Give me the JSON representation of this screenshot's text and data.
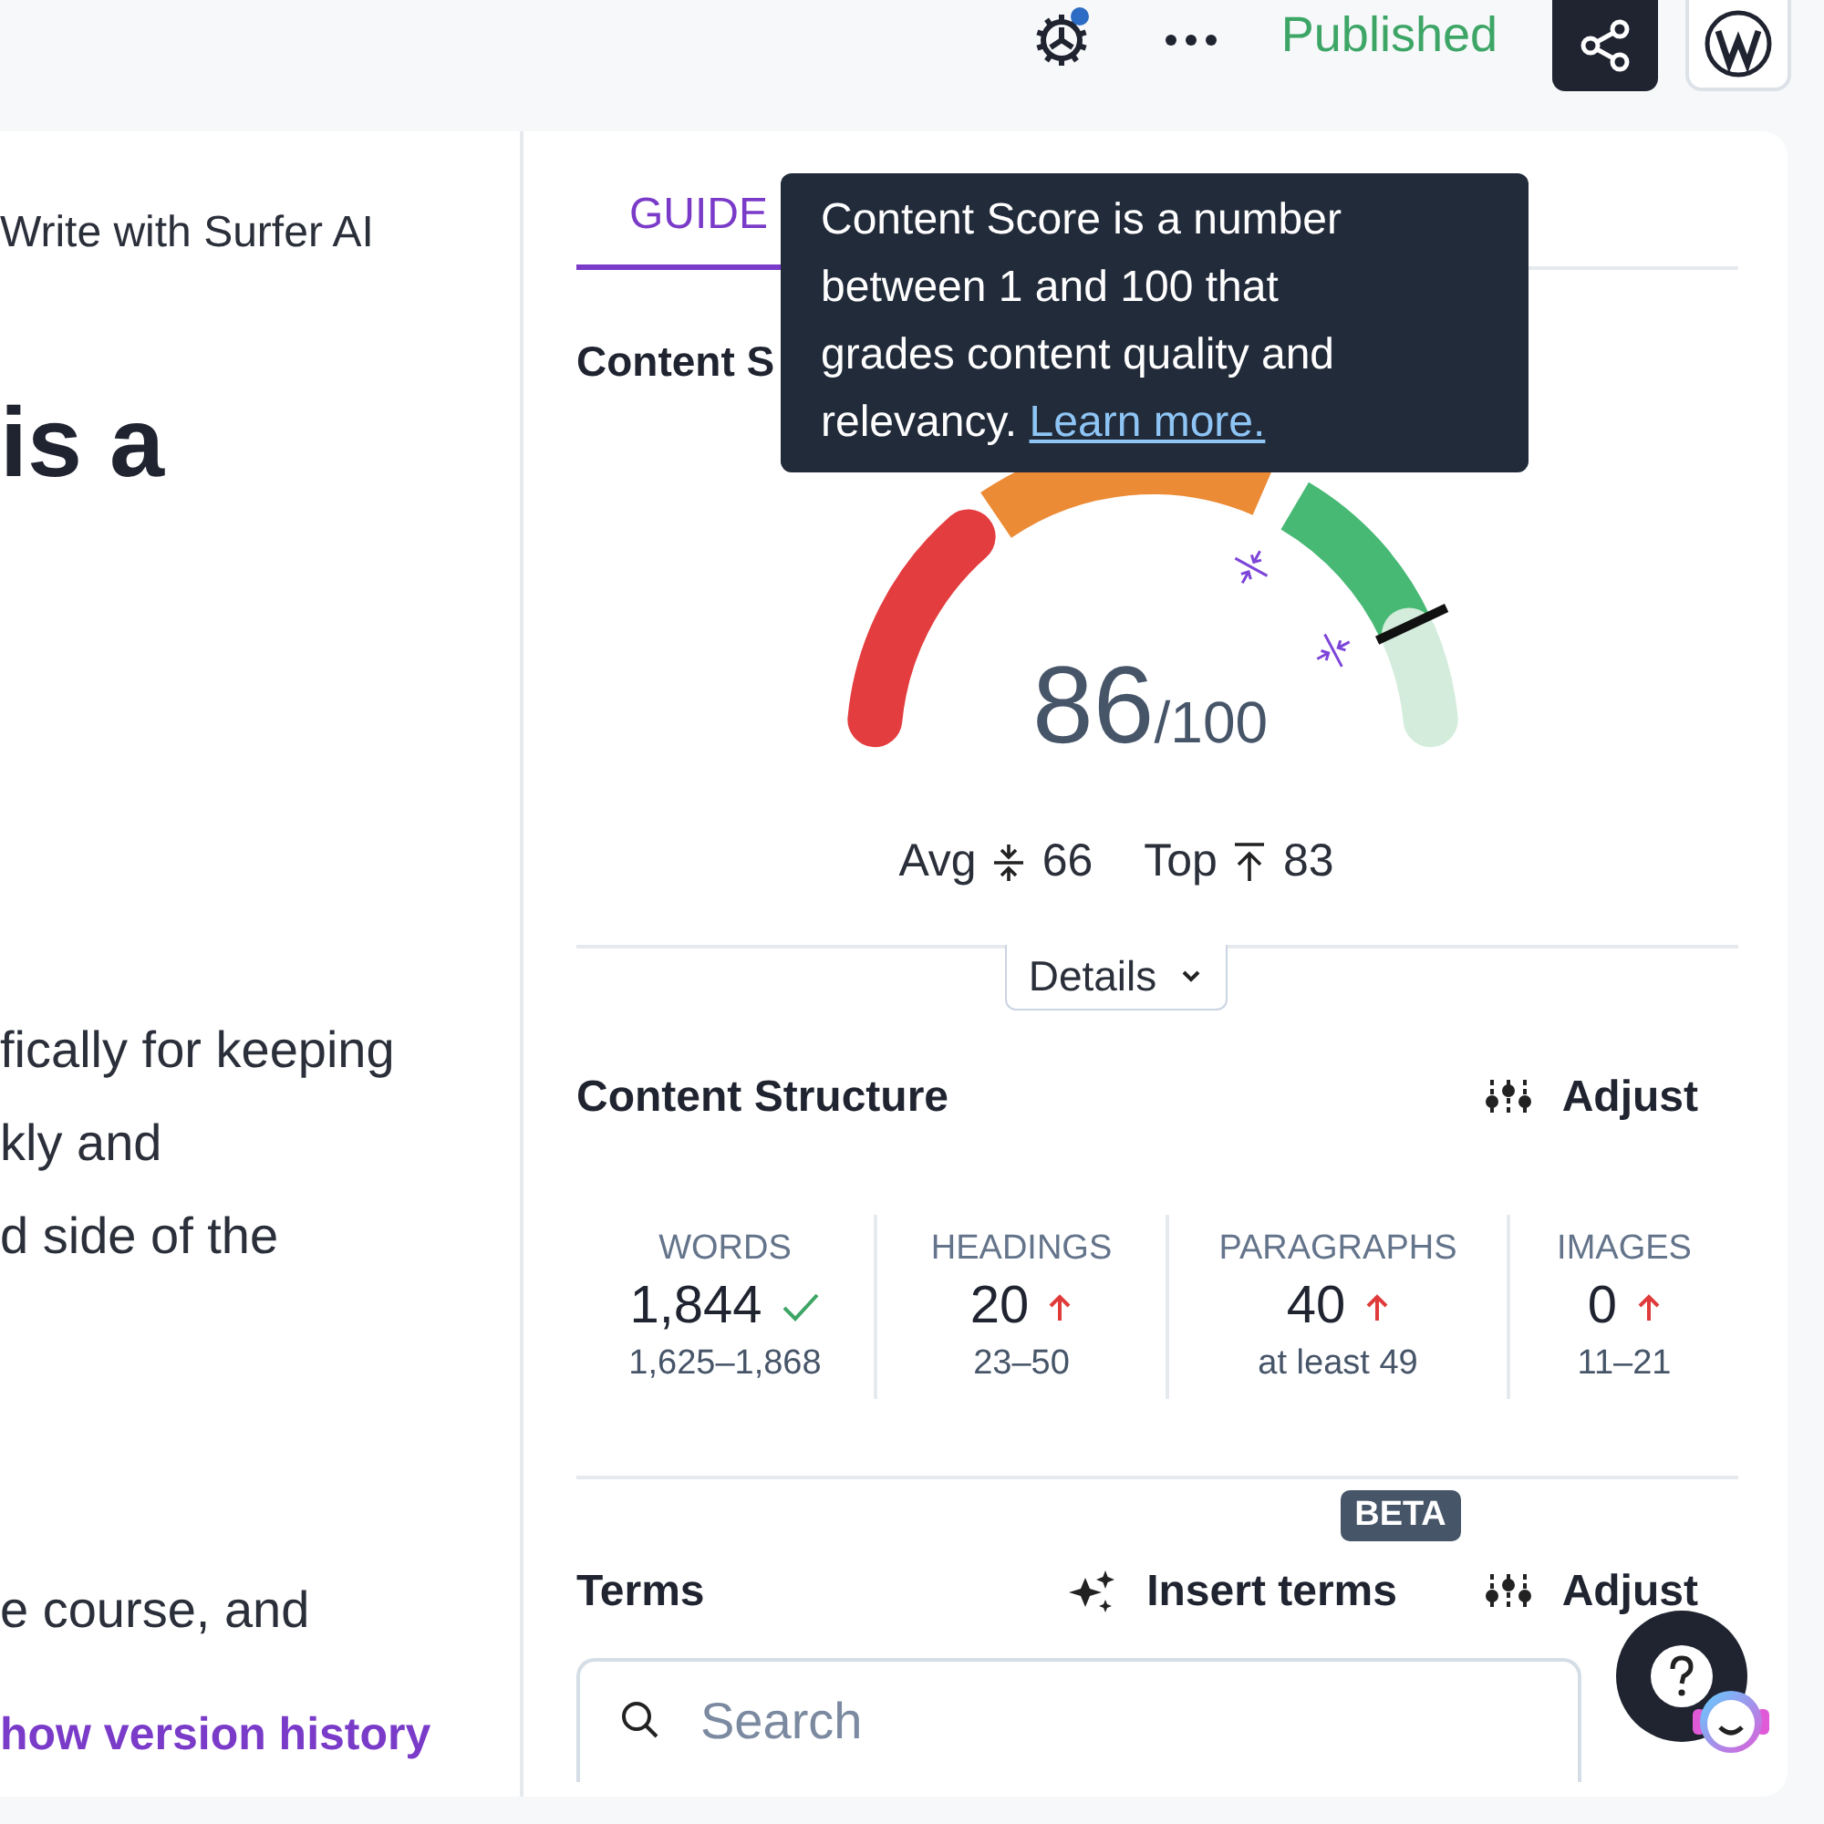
{
  "topbar": {
    "status": "Published",
    "settings_badge": true
  },
  "editor": {
    "ai_link": "Write with Surfer AI",
    "heading": "is a",
    "paragraph_1": [
      "fically for keeping",
      "kly and",
      "d side of the"
    ],
    "paragraph_2": "e course, and",
    "history_link": "how version history"
  },
  "tabs": [
    {
      "label": "GUIDE",
      "selected": true
    }
  ],
  "tooltip": {
    "lines": [
      "Content Score is a number",
      "between 1 and 100 that",
      "grades content quality and"
    ],
    "last_line": "relevancy.",
    "link": "Learn more."
  },
  "content_score": {
    "title": "Content S",
    "score": "86",
    "max": "/100",
    "avg": {
      "label": "Avg",
      "value": "66"
    },
    "top": {
      "label": "Top",
      "value": "83"
    },
    "details_button": "Details"
  },
  "content_structure": {
    "title": "Content Structure",
    "adjust": "Adjust",
    "stats": [
      {
        "label": "WORDS",
        "value": "1,844",
        "kind": "ok",
        "range": "1,625–1,868"
      },
      {
        "label": "HEADINGS",
        "value": "20",
        "kind": "low",
        "range": "23–50"
      },
      {
        "label": "PARAGRAPHS",
        "value": "40",
        "kind": "low",
        "range": "at least 49"
      },
      {
        "label": "IMAGES",
        "value": "0",
        "kind": "low",
        "range": "11–21"
      }
    ]
  },
  "terms": {
    "title": "Terms",
    "insert": "Insert terms",
    "badge": "BETA",
    "adjust": "Adjust",
    "search": {
      "placeholder": "Search"
    }
  }
}
